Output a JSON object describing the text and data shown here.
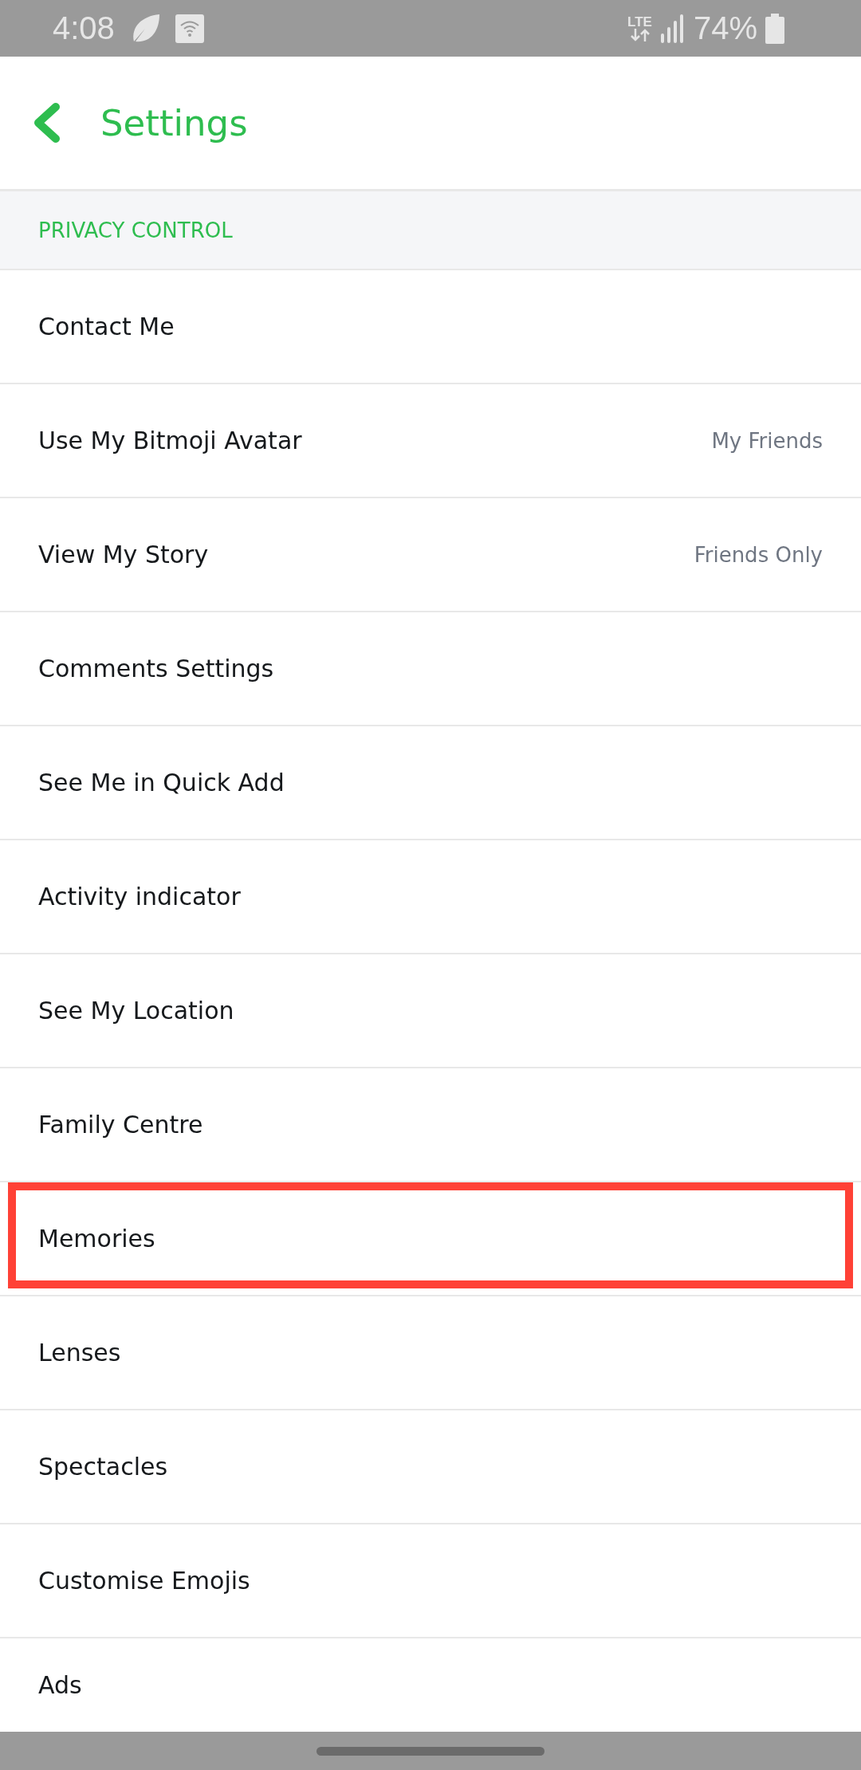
{
  "status_bar": {
    "time": "4:08",
    "network": "LTE",
    "battery": "74%"
  },
  "header": {
    "title": "Settings"
  },
  "section": {
    "title": "PRIVACY CONTROL"
  },
  "rows": [
    {
      "label": "Contact Me",
      "highlighted": false
    },
    {
      "label": "Use My Bitmoji Avatar",
      "value": "My Friends",
      "highlighted": false
    },
    {
      "label": "View My Story",
      "value": "Friends Only",
      "highlighted": false
    },
    {
      "label": "Comments Settings",
      "highlighted": false
    },
    {
      "label": "See Me in Quick Add",
      "highlighted": false
    },
    {
      "label": "Activity indicator",
      "highlighted": false
    },
    {
      "label": "See My Location",
      "highlighted": false
    },
    {
      "label": "Family Centre",
      "highlighted": false
    },
    {
      "label": "Memories",
      "highlighted": true
    },
    {
      "label": "Lenses",
      "highlighted": false
    },
    {
      "label": "Spectacles",
      "highlighted": false
    },
    {
      "label": "Customise Emojis",
      "highlighted": false
    },
    {
      "label": "Ads",
      "highlighted": false
    }
  ]
}
